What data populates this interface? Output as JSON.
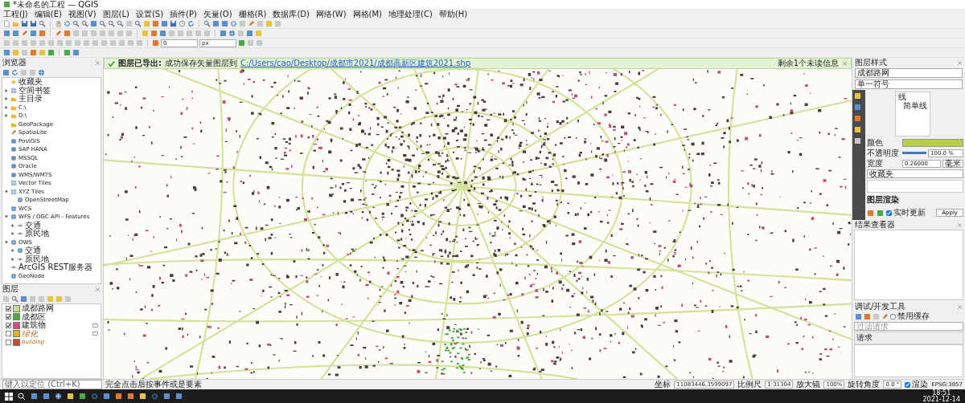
{
  "window": {
    "title": "*未命名的工程 — QGIS"
  },
  "menu": [
    "工程(J)",
    "编辑(E)",
    "视图(V)",
    "图层(L)",
    "设置(S)",
    "插件(P)",
    "矢量(O)",
    "栅格(R)",
    "数据库(D)",
    "网络(W)",
    "网格(M)",
    "地理处理(C)",
    "帮助(H)"
  ],
  "toolbar": {
    "snap_field": {
      "value": "0"
    },
    "unit_field": {
      "value": "px"
    }
  },
  "message_bar": {
    "title": "图层已导出:",
    "text": "成功保存矢量图层到",
    "link": "C:/Users/cao/Desktop/成都市2021/成都高新区建筑2021.shp",
    "note": "剩余1个未读信息"
  },
  "browser": {
    "title": "浏览器",
    "items": [
      {
        "label": "收藏夹",
        "kind": "leaf",
        "expanded": false
      },
      {
        "label": "空间书签",
        "kind": "branch",
        "expanded": false
      },
      {
        "label": "主目录",
        "kind": "branch",
        "expanded": false
      },
      {
        "label": "C:\\",
        "kind": "branch",
        "expanded": false
      },
      {
        "label": "D:\\",
        "kind": "branch",
        "expanded": false
      },
      {
        "label": "GeoPackage",
        "kind": "leaf",
        "expanded": false
      },
      {
        "label": "SpatiaLite",
        "kind": "leaf",
        "expanded": false
      },
      {
        "label": "PostGIS",
        "kind": "leaf",
        "expanded": false
      },
      {
        "label": "SAP HANA",
        "kind": "leaf",
        "expanded": false
      },
      {
        "label": "MSSQL",
        "kind": "leaf",
        "expanded": false
      },
      {
        "label": "Oracle",
        "kind": "leaf",
        "expanded": false
      },
      {
        "label": "WMS/WMTS",
        "kind": "leaf",
        "expanded": false
      },
      {
        "label": "Vector Tiles",
        "kind": "leaf",
        "expanded": false
      },
      {
        "label": "XYZ Tiles",
        "kind": "branch",
        "expanded": true,
        "children": [
          {
            "label": "OpenStreetMap",
            "kind": "leaf",
            "expanded": false
          }
        ]
      },
      {
        "label": "WCS",
        "kind": "leaf",
        "expanded": false
      },
      {
        "label": "WFS / OGC API - Features",
        "kind": "branch",
        "expanded": true,
        "children": [
          {
            "label": "交通",
            "kind": "branch",
            "expanded": false
          },
          {
            "label": "原民地",
            "kind": "branch",
            "expanded": false
          }
        ]
      },
      {
        "label": "OWS",
        "kind": "branch",
        "expanded": true,
        "children": [
          {
            "label": "交通",
            "kind": "branch",
            "expanded": false
          },
          {
            "label": "原民地",
            "kind": "branch",
            "expanded": false
          }
        ]
      },
      {
        "label": "ArcGIS REST服务器",
        "kind": "leaf",
        "expanded": false
      },
      {
        "label": "GeoNode",
        "kind": "leaf",
        "expanded": false
      }
    ]
  },
  "layers": {
    "title": "图层",
    "items": [
      {
        "name": "成都路网",
        "checked": true,
        "color": "#c9dc8e",
        "italic": false,
        "indicator": false
      },
      {
        "name": "成都区",
        "checked": true,
        "color": "#4fa83c",
        "italic": false,
        "indicator": false
      },
      {
        "name": "建筑物",
        "checked": true,
        "color": "#d0507a",
        "italic": false,
        "indicator": true
      },
      {
        "name": "绿化",
        "checked": false,
        "color": "#e0b030",
        "italic": true,
        "indicator": true
      },
      {
        "name": "building",
        "checked": false,
        "color": "#d04a2a",
        "italic": true,
        "indicator": false
      }
    ]
  },
  "layer_styling": {
    "title": "图层样式",
    "layer": "成都路网",
    "renderer": "单一符号",
    "symbol_tree": [
      "线",
      "简单线"
    ],
    "color_row": {
      "label": "颜色",
      "color": "#b7cf48"
    },
    "opacity": {
      "label": "不透明度",
      "level": 1.0,
      "value": "100.0 %"
    },
    "width": {
      "label": "宽度",
      "value": "0.26000",
      "unit": "毫米"
    },
    "search": {
      "value": "收藏夹"
    },
    "rendering": "图层渲染",
    "live_update": {
      "label": "实时更新",
      "checked": true
    },
    "apply": "Apply"
  },
  "results_viewer": {
    "title": "结果查看器"
  },
  "debug_tools": {
    "title": "调试/开发工具",
    "disable_cache": {
      "label": "禁用缓存",
      "checked": false
    },
    "filter": {
      "placeholder": "过滤请求"
    },
    "column": "请求"
  },
  "status_bar": {
    "search": {
      "placeholder": "键入以定位 (Ctrl+K)"
    },
    "message": "完全点击后按事件或是要素",
    "coordinate": {
      "label": "坐标",
      "value": "11083446,3599097"
    },
    "scale": {
      "label": "比例尺",
      "value": "1:31304"
    },
    "magnifier": {
      "label": "放大镜",
      "value": "100%"
    },
    "rotation": {
      "label": "旋转角度",
      "value": "0.0 °"
    },
    "render": {
      "label": "渲染",
      "checked": true
    },
    "crs": "EPSG:3857"
  },
  "taskbar": {
    "time": "18:51",
    "date": "2021-12-14"
  }
}
